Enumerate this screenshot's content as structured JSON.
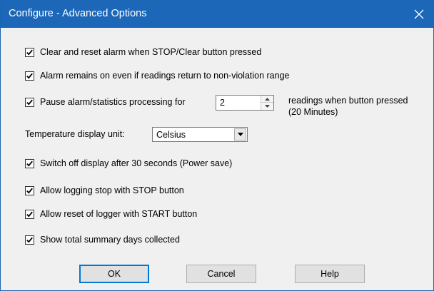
{
  "window": {
    "title": "Configure - Advanced Options"
  },
  "options": {
    "clear_reset_alarm": {
      "label": "Clear and reset alarm when STOP/Clear button pressed",
      "checked": true
    },
    "alarm_remains_on": {
      "label": "Alarm remains on even if readings return to non-violation range",
      "checked": true
    },
    "pause_alarm": {
      "label": "Pause alarm/statistics processing for",
      "checked": true,
      "value": "2",
      "suffix": "readings when button pressed (20 Minutes)"
    },
    "temperature_unit": {
      "label": "Temperature display unit:",
      "selected": "Celsius"
    },
    "switch_off_display": {
      "label": "Switch off display after 30 seconds (Power save)",
      "checked": true
    },
    "allow_logging_stop": {
      "label": "Allow logging stop with STOP button",
      "checked": true
    },
    "allow_reset_logger": {
      "label": "Allow reset of logger with START button",
      "checked": true
    },
    "show_summary_days": {
      "label": "Show total summary days collected",
      "checked": true
    }
  },
  "buttons": {
    "ok": "OK",
    "cancel": "Cancel",
    "help": "Help"
  },
  "icons": {
    "close": "close-icon",
    "checkbox": "checkmark-icon",
    "spin_up": "spin-up-arrow-icon",
    "spin_down": "spin-down-arrow-icon",
    "dropdown": "chevron-down-icon"
  },
  "colors": {
    "titlebar": "#1c67b8",
    "dialog_background": "#f0f0f0",
    "default_button_border": "#0078d7"
  }
}
